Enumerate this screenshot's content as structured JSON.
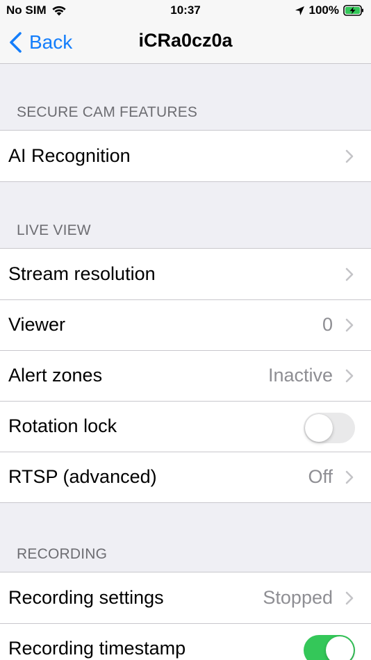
{
  "status_bar": {
    "carrier": "No SIM",
    "time": "10:37",
    "battery": "100%"
  },
  "nav": {
    "back_label": "Back",
    "title": "iCRa0cz0a"
  },
  "sections": [
    {
      "header": "SECURE CAM FEATURES",
      "rows": [
        {
          "label": "AI Recognition",
          "value": "",
          "type": "chevron"
        }
      ]
    },
    {
      "header": "LIVE VIEW",
      "rows": [
        {
          "label": "Stream resolution",
          "value": "",
          "type": "chevron"
        },
        {
          "label": "Viewer",
          "value": "0",
          "type": "chevron"
        },
        {
          "label": "Alert zones",
          "value": "Inactive",
          "type": "chevron"
        },
        {
          "label": "Rotation lock",
          "value": "",
          "type": "toggle",
          "on": false
        },
        {
          "label": "RTSP (advanced)",
          "value": "Off",
          "type": "chevron"
        }
      ]
    },
    {
      "header": "RECORDING",
      "rows": [
        {
          "label": "Recording settings",
          "value": "Stopped",
          "type": "chevron"
        },
        {
          "label": "Recording timestamp",
          "value": "",
          "type": "toggle",
          "on": true
        }
      ]
    }
  ],
  "colors": {
    "accent": "#147efb",
    "toggle_on": "#34c759",
    "toggle_off": "#e9e9ea",
    "background": "#efeff4"
  }
}
